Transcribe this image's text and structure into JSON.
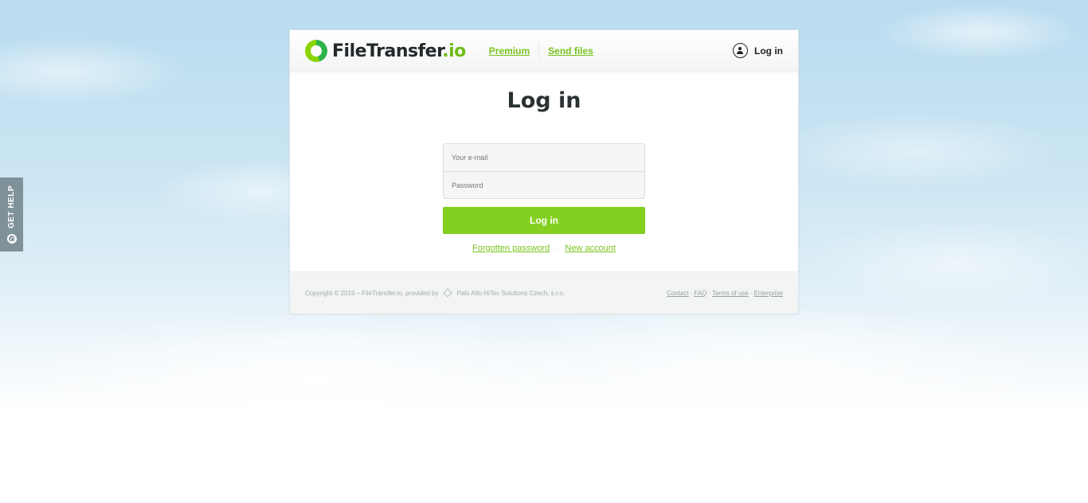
{
  "help_tab": {
    "label": "GET HELP",
    "icon": "lifebuoy-icon"
  },
  "header": {
    "logo_name": "FileTransfer",
    "logo_tld": ".io",
    "nav": [
      {
        "label": "Premium"
      },
      {
        "label": "Send files"
      }
    ],
    "login_label": "Log in",
    "login_icon": "user-icon"
  },
  "main": {
    "title": "Log in",
    "email_placeholder": "Your e-mail",
    "password_placeholder": "Password",
    "submit_label": "Log in",
    "forgot_label": "Forgotten password",
    "separator": "·",
    "new_account_label": "New account"
  },
  "footer": {
    "copyright": "Copyright © 2019 – FileTransfer.io, provided by",
    "provider": "Palo Alto HiTec Solutions Czech, s.r.o.",
    "links": [
      "Contact",
      "FAQ",
      "Terms of use",
      "Enterprise"
    ],
    "link_separator": "·"
  },
  "colors": {
    "accent_green": "#84d021",
    "link_green": "#79c21d",
    "help_tab": "#7f9299"
  }
}
